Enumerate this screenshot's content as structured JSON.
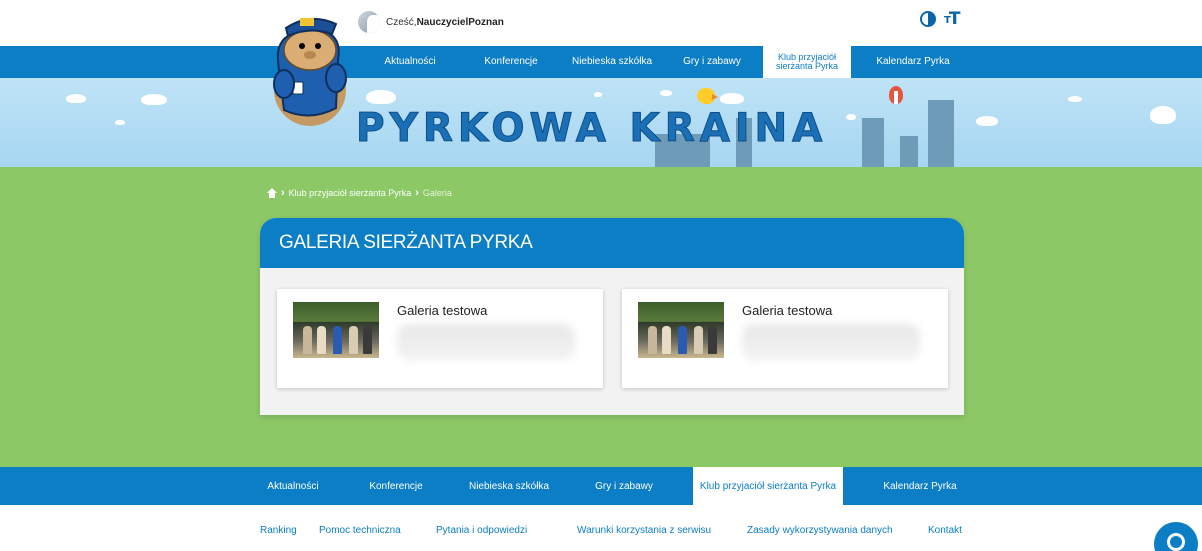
{
  "user": {
    "greeting": "Cześć, ",
    "name": "NauczycielPoznan"
  },
  "tools": {
    "contrast_icon": "contrast-icon",
    "fontsize_icon": "font-size-icon"
  },
  "nav": {
    "items": [
      {
        "label": "Aktualności"
      },
      {
        "label": "Konferencje"
      },
      {
        "label": "Niebieska szkółka"
      },
      {
        "label": "Gry i zabawy"
      },
      {
        "label": "Klub przyjaciół sierżanta Pyrka",
        "active": true
      },
      {
        "label": "Kalendarz Pyrka"
      }
    ]
  },
  "banner": {
    "title": "PYRKOWA KRAINA"
  },
  "breadcrumb": {
    "items": [
      "Klub przyjaciół sierżanta Pyrka",
      "Galeria"
    ]
  },
  "gallery": {
    "title": "GALERIA SIERŻANTA PYRKA",
    "cards": [
      {
        "title": "Galeria testowa"
      },
      {
        "title": "Galeria testowa"
      }
    ]
  },
  "footer_nav": {
    "items": [
      {
        "label": "Aktualności"
      },
      {
        "label": "Konferencje"
      },
      {
        "label": "Niebieska szkółka"
      },
      {
        "label": "Gry i zabawy"
      },
      {
        "label": "Klub przyjaciół sierżanta Pyrka",
        "active": true
      },
      {
        "label": "Kalendarz Pyrka"
      }
    ]
  },
  "footer_links": [
    "Ranking",
    "Pomoc techniczna",
    "Pytania i odpowiedzi",
    "Warunki korzystania z serwisu",
    "Zasady wykorzystywania danych",
    "Kontakt"
  ],
  "colors": {
    "primary": "#0b7ec6",
    "green": "#8dc866",
    "sky": "#a6d6f1"
  }
}
